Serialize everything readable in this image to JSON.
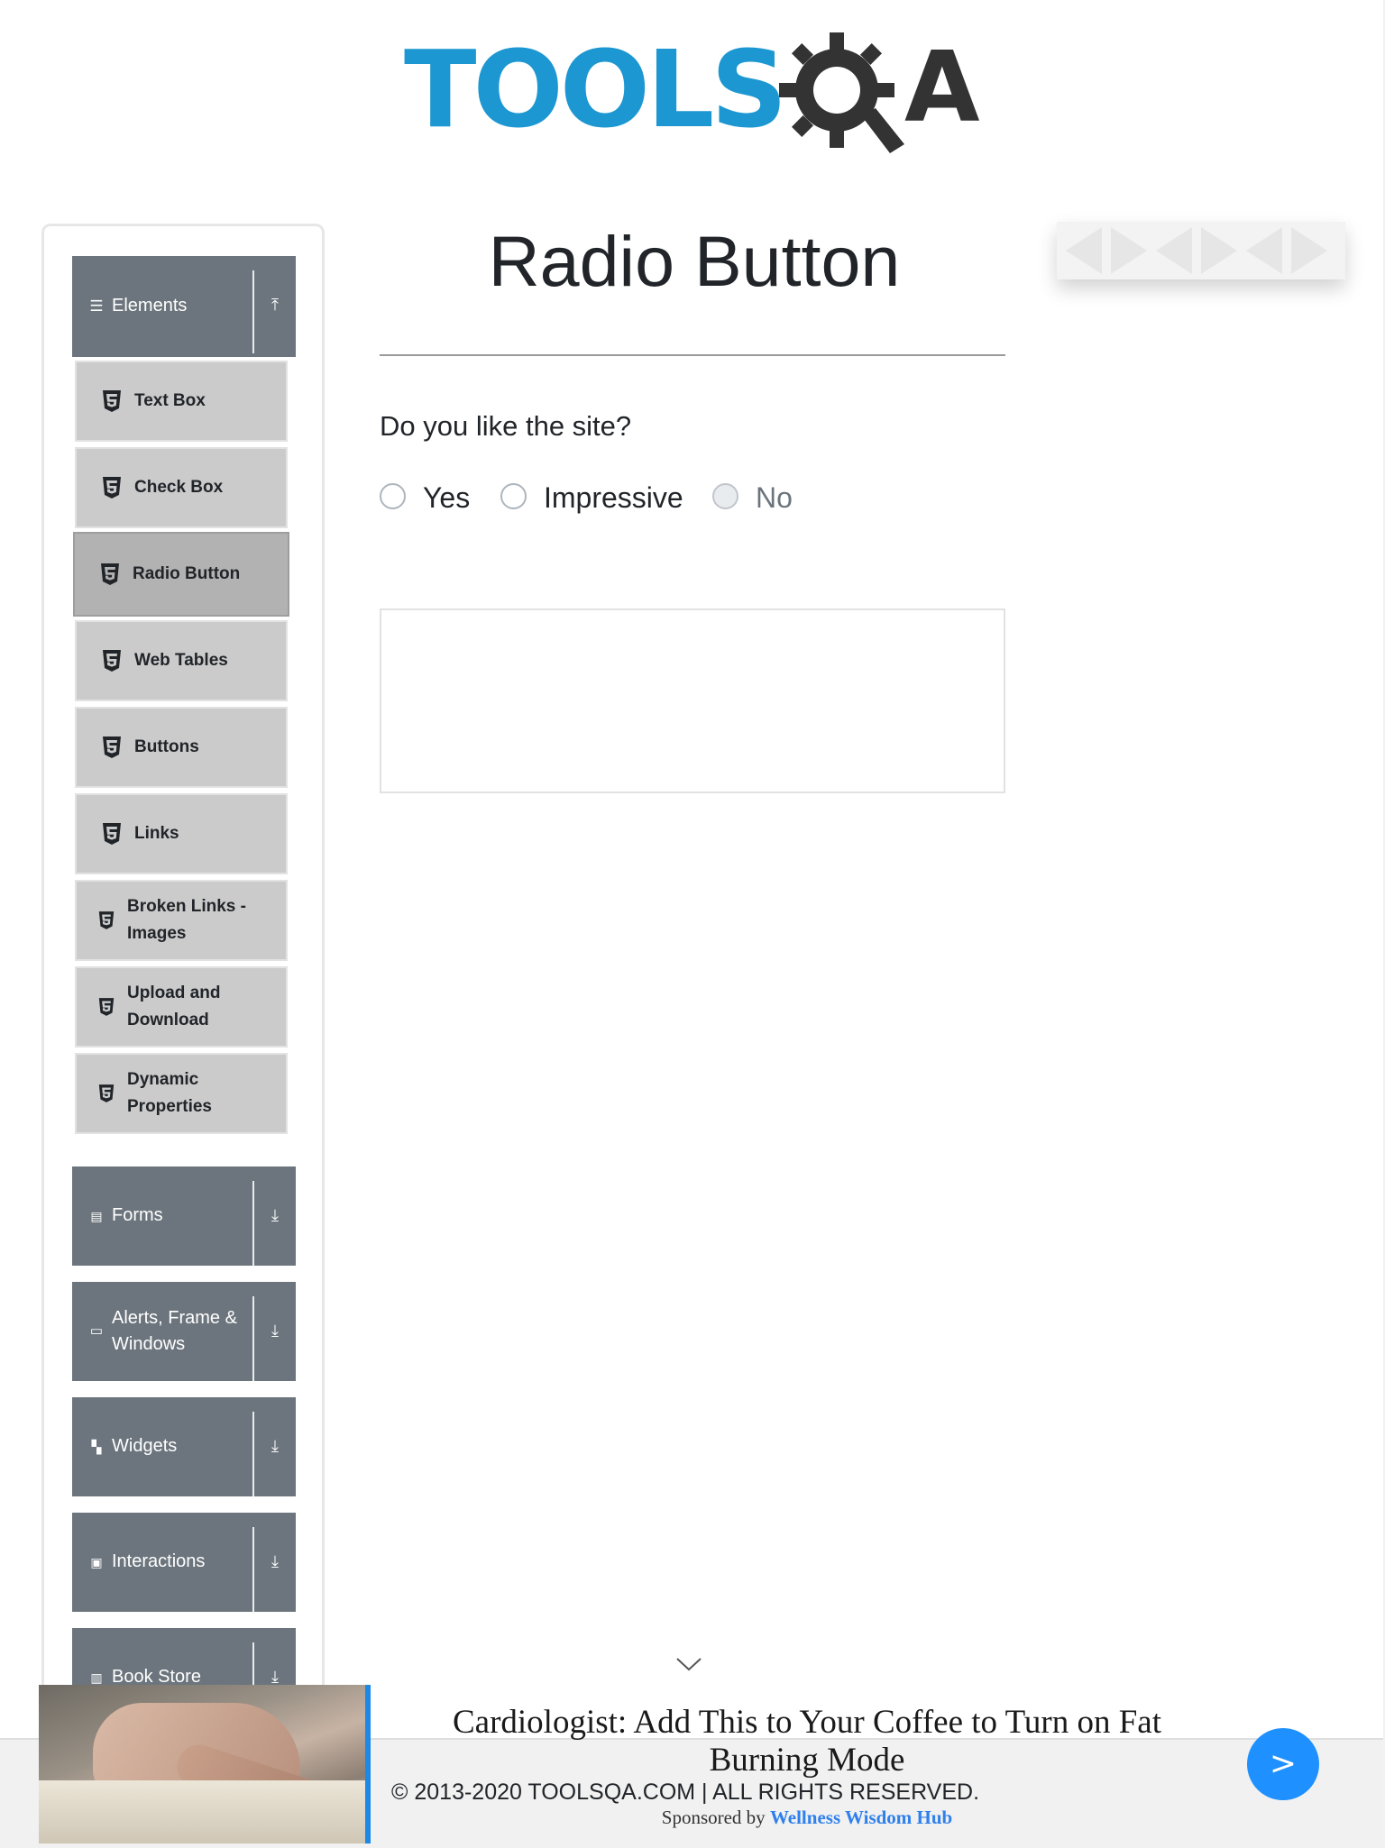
{
  "logo": {
    "text_blue": "TOOLS",
    "text_dark": "A"
  },
  "sidebar": {
    "groups": [
      {
        "label": "Elements",
        "icon": "hamburger-icon",
        "toggle": "collapse-arrow-up-icon",
        "expanded": true
      },
      {
        "label": "Forms",
        "icon": "document-icon",
        "toggle": "expand-arrow-down-icon"
      },
      {
        "label": "Alerts, Frame & Windows",
        "icon": "window-icon",
        "toggle": "expand-arrow-down-icon"
      },
      {
        "label": "Widgets",
        "icon": "widgets-icon",
        "toggle": "expand-arrow-down-icon"
      },
      {
        "label": "Interactions",
        "icon": "interaction-icon",
        "toggle": "expand-arrow-down-icon"
      },
      {
        "label": "Book Store",
        "icon": "books-icon",
        "toggle": "expand-arrow-down-icon"
      }
    ],
    "elements_items": [
      {
        "label": "Text Box"
      },
      {
        "label": "Check Box"
      },
      {
        "label": "Radio Button",
        "active": true
      },
      {
        "label": "Web Tables"
      },
      {
        "label": "Buttons"
      },
      {
        "label": "Links"
      },
      {
        "label": "Broken Links - Images"
      },
      {
        "label": "Upload and Download"
      },
      {
        "label": "Dynamic Properties"
      }
    ]
  },
  "main": {
    "title": "Radio Button",
    "question": "Do you like the site?",
    "options": [
      {
        "label": "Yes",
        "checked": false,
        "disabled": false
      },
      {
        "label": "Impressive",
        "checked": false,
        "disabled": false
      },
      {
        "label": "No",
        "checked": false,
        "disabled": true
      }
    ],
    "result_text": ""
  },
  "footer": {
    "text": "© 2013-2020 TOOLSQA.COM | ALL RIGHTS RESERVED."
  },
  "ad": {
    "headline": "Cardiologist: Add This to Your Coffee to Turn on Fat Burning Mode",
    "sponsored_prefix": "Sponsored by",
    "sponsor": "Wellness Wisdom Hub",
    "go_label": ">",
    "accent_color": "#1e88e5"
  },
  "colors": {
    "brand_blue": "#1c97d2",
    "sidebar_header": "#6c757d",
    "menu_item": "#cbcbcb",
    "menu_item_active": "#b2b2b2"
  }
}
